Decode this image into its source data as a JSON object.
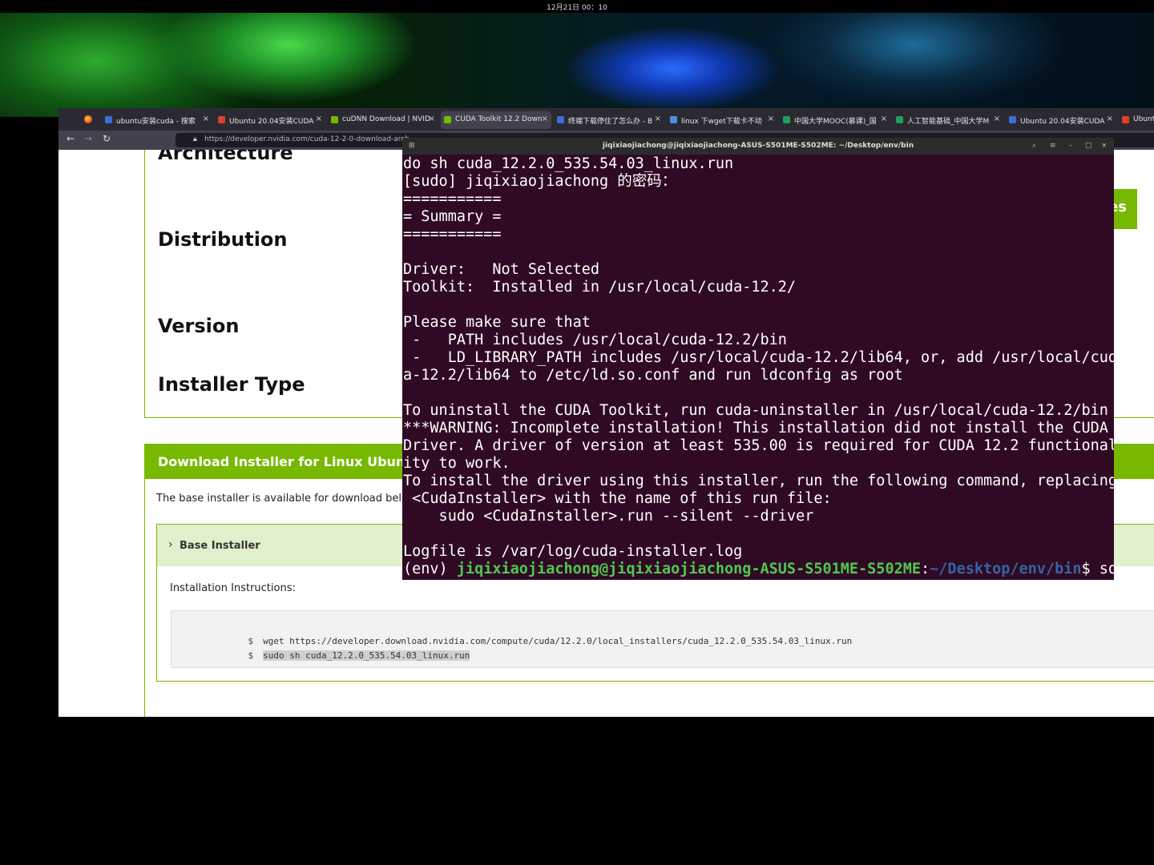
{
  "topbar": {
    "clock": "12月21日 00：10"
  },
  "browser": {
    "tabs": [
      {
        "label": "ubuntu安装cuda - 搜索",
        "color": "#3b6fd6"
      },
      {
        "label": "Ubuntu 20.04安装CUDA",
        "color": "#e0402a"
      },
      {
        "label": "cuDNN Download | NVID",
        "color": "#76b900"
      },
      {
        "label": "CUDA Toolkit 12.2 Down",
        "color": "#76b900",
        "active": true
      },
      {
        "label": "终端下载停住了怎么办 - B",
        "color": "#3b6fd6"
      },
      {
        "label": "linux 下wget下载卡不动",
        "color": "#4a90e2"
      },
      {
        "label": "中国大学MOOC(慕课)_国",
        "color": "#1fa05a"
      },
      {
        "label": "人工智能基础_中国大学M",
        "color": "#1fa05a"
      },
      {
        "label": "Ubuntu 20.04安装CUDA",
        "color": "#3b6fd6"
      },
      {
        "label": "Ubuntu",
        "color": "#e0402a"
      }
    ],
    "tab_close": "×",
    "nav": {
      "back": "←",
      "forward": "→",
      "reload": "↻"
    },
    "url": "https://developer.nvidia.com/cuda-12-2-0-download-arch"
  },
  "page": {
    "rows": {
      "architecture": "Architecture",
      "distribution": "Distribution",
      "version": "Version",
      "installer_type": "Installer Type"
    },
    "green_button_fragment": "es",
    "download_header": "Download Installer for Linux Ubuntu",
    "download_note": "The base installer is available for download belo",
    "base_installer_label": "Base Installer",
    "installation_instructions": "Installation Instructions:",
    "prompt": "$",
    "cmd1": "wget https://developer.download.nvidia.com/compute/cuda/12.2.0/local_installers/cuda_12.2.0_535.54.03_linux.run",
    "cmd2": "sudo sh cuda_12.2.0_535.54.03_linux.run"
  },
  "terminal": {
    "title": "jiqixiaojiachong@jiqixiaojiachong-ASUS-S501ME-S502ME: ~/Desktop/env/bin",
    "lines": [
      "do sh cuda_12.2.0_535.54.03_linux.run",
      "[sudo] jiqixiaojiachong 的密码：",
      "===========",
      "= Summary =",
      "===========",
      "",
      "Driver:   Not Selected",
      "Toolkit:  Installed in /usr/local/cuda-12.2/",
      "",
      "Please make sure that",
      " -   PATH includes /usr/local/cuda-12.2/bin",
      " -   LD_LIBRARY_PATH includes /usr/local/cuda-12.2/lib64, or, add /usr/local/cud",
      "a-12.2/lib64 to /etc/ld.so.conf and run ldconfig as root",
      "",
      "To uninstall the CUDA Toolkit, run cuda-uninstaller in /usr/local/cuda-12.2/bin",
      "***WARNING: Incomplete installation! This installation did not install the CUDA",
      "Driver. A driver of version at least 535.00 is required for CUDA 12.2 functional",
      "ity to work.",
      "To install the driver using this installer, run the following command, replacing",
      " <CudaInstaller> with the name of this run file:",
      "    sudo <CudaInstaller>.run --silent --driver",
      "",
      "Logfile is /var/log/cuda-installer.log"
    ],
    "prompt": {
      "env": "(env) ",
      "user_host": "jiqixiaojiachong@jiqixiaojiachong-ASUS-S501ME-S502ME",
      "colon": ":",
      "path": "~/Desktop/env/bin",
      "dollar": "$ ",
      "typed": "so"
    }
  },
  "icons": {
    "tab_favicon": "favicon-icon",
    "firefox": "firefox-icon",
    "lock": "lock-icon"
  }
}
